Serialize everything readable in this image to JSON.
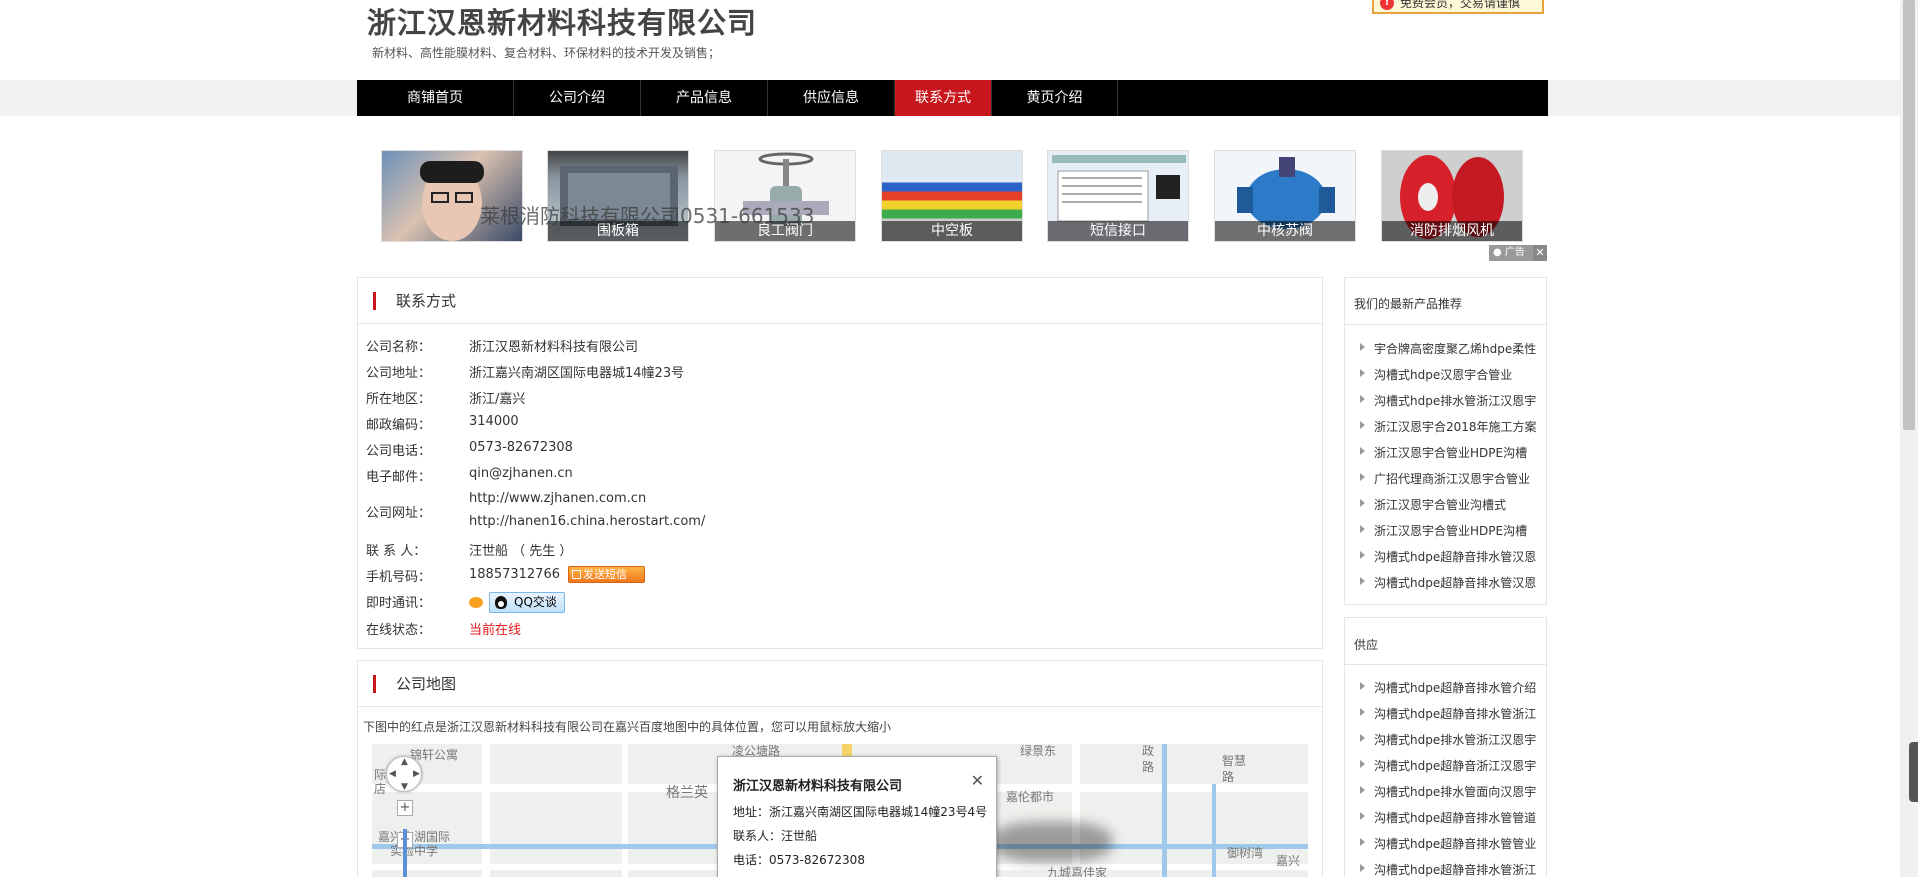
{
  "header": {
    "company_name": "浙江汉恩新材料科技有限公司",
    "business_scope": "新材料、高性能膜材料、复合材料、环保材料的技术开发及销售；",
    "notice": "免费会员，交易请谨慎"
  },
  "nav": {
    "items": [
      "商铺首页",
      "公司介绍",
      "产品信息",
      "供应信息",
      "联系方式",
      "黄页介绍"
    ],
    "active": "联系方式"
  },
  "thumbnails": [
    {
      "caption": ""
    },
    {
      "caption": "围板箱"
    },
    {
      "caption": "良工阀门"
    },
    {
      "caption": "中空板"
    },
    {
      "caption": "短信接口"
    },
    {
      "caption": "中核苏阀"
    },
    {
      "caption": "消防排烟风机"
    }
  ],
  "overlay_text": "莱根消防科技有限公司0531-661533",
  "ad_label": "广告",
  "contact": {
    "title": "联系方式",
    "rows": {
      "company_name": {
        "label": "公司名称：",
        "value": "浙江汉恩新材料科技有限公司"
      },
      "address": {
        "label": "公司地址：",
        "value": "浙江嘉兴南湖区国际电器城14幢23号"
      },
      "region": {
        "label": "所在地区：",
        "value": "浙江/嘉兴"
      },
      "postcode": {
        "label": "邮政编码：",
        "value": "314000"
      },
      "phone": {
        "label": "公司电话：",
        "value": "0573-82672308"
      },
      "email": {
        "label": "电子邮件：",
        "value": "qin@zjhanen.cn"
      },
      "website": {
        "label": "公司网址：",
        "value": "http://www.zjhanen.com.cn",
        "value2": "http://hanen16.china.herostart.com/"
      },
      "contact_person": {
        "label": "联 系 人：",
        "value": "汪世船 （ 先生 ）"
      },
      "mobile": {
        "label": "手机号码：",
        "value": "18857312766",
        "sms_button": "发送短信"
      },
      "im": {
        "label": "即时通讯：",
        "qq_button": "QQ交谈"
      },
      "status": {
        "label": "在线状态：",
        "value": "当前在线"
      }
    }
  },
  "map": {
    "title": "公司地图",
    "description": "下图中的红点是浙江汉恩新材料科技有限公司在嘉兴百度地图中的具体位置，您可以用鼠标放大缩小",
    "labels": [
      "凌公塘路",
      "格兰英",
      "锦轩公寓",
      "际",
      "店",
      "嘉兴南湖国际",
      "实验中学",
      "绿景东",
      "政",
      "路",
      "智慧",
      "路",
      "嘉伦都市",
      "九城嘉佳家",
      "御树湾",
      "嘉兴"
    ],
    "info": {
      "title": "浙江汉恩新材料科技有限公司",
      "address": "地址：浙江嘉兴南湖区国际电器城14幢23号4号",
      "contact": "联系人：汪世船",
      "phone": "电话：0573-82672308"
    }
  },
  "sidebar": {
    "latest_title": "我们的最新产品推荐",
    "latest_items": [
      "宇合牌高密度聚乙烯hdpe柔性",
      "沟槽式hdpe汉恩宇合管业",
      "沟槽式hdpe排水管浙江汉恩宇",
      "浙江汉恩宇合2018年施工方案",
      "浙江汉恩宇合管业HDPE沟槽",
      "广招代理商浙江汉恩宇合管业",
      "浙江汉恩宇合管业沟槽式",
      "浙江汉恩宇合管业HDPE沟槽",
      "沟槽式hdpe超静音排水管汉恩",
      "沟槽式hdpe超静音排水管汉恩"
    ],
    "supply_title": "供应",
    "supply_items": [
      "沟槽式hdpe超静音排水管介绍",
      "沟槽式hdpe超静音排水管浙江",
      "沟槽式hdpe排水管浙江汉恩宇",
      "沟槽式hdpe超静音浙江汉恩宇",
      "沟槽式hdpe排水管面向汉恩宇",
      "沟槽式hdpe超静音排水管管道",
      "沟槽式hdpe超静音排水管管业",
      "沟槽式hdpe超静音排水管浙江"
    ]
  },
  "colors": {
    "accent": "#c8161d",
    "nav_bg": "#000000",
    "online": "#e21a1a"
  }
}
